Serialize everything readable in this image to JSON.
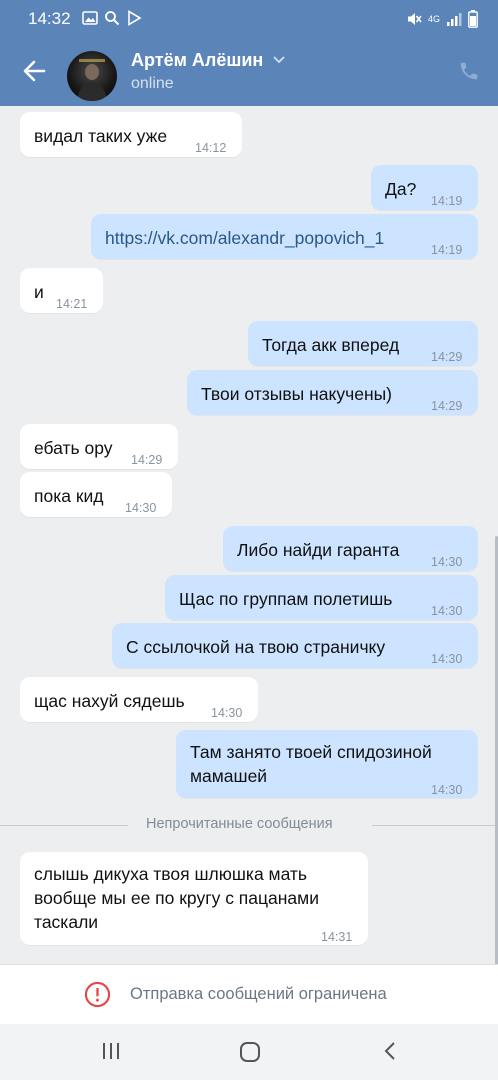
{
  "status_bar": {
    "time": "14:32",
    "network": "4G"
  },
  "header": {
    "contact_name": "Артём Алёшин",
    "contact_status": "online"
  },
  "messages": [
    {
      "text": "видал таких уже",
      "time": "14:12"
    },
    {
      "text": "Да?",
      "time": "14:19"
    },
    {
      "text": "https://vk.com/alexandr_popovich_1",
      "time": "14:19"
    },
    {
      "text": "и",
      "time": "14:21"
    },
    {
      "text": "Тогда акк вперед",
      "time": "14:29"
    },
    {
      "text": "Твои отзывы накучены)",
      "time": "14:29"
    },
    {
      "text": "ебать ору",
      "time": "14:29"
    },
    {
      "text": "пока кид",
      "time": "14:30"
    },
    {
      "text": "Либо найди гаранта",
      "time": "14:30"
    },
    {
      "text": "Щас по группам полетишь",
      "time": "14:30"
    },
    {
      "text": "С ссылочкой на твою страничку",
      "time": "14:30"
    },
    {
      "text": "щас нахуй сядешь",
      "time": "14:30"
    },
    {
      "lines": [
        "Там занято твоей спидозиной",
        "мамашей"
      ],
      "time": "14:30"
    },
    {
      "lines": [
        "слышь дикуха твоя шлюшка мать",
        "вообще мы ее по кругу с пацанами",
        "таскали"
      ],
      "time": "14:31"
    }
  ],
  "unread_divider": "Непрочитанные сообщения",
  "restriction": {
    "text": "Отправка сообщений ограничена"
  },
  "icons": {
    "back": "arrow-left-icon",
    "call": "phone-icon",
    "warning": "warning-circle-icon",
    "nav_recent": "recent-apps-icon",
    "nav_home": "home-icon",
    "nav_back": "chevron-left-icon"
  },
  "colors": {
    "header": "#5b84b9",
    "outgoing": "#cce4ff",
    "incoming": "#ffffff",
    "background": "#edeef0",
    "warning": "#e64646"
  }
}
